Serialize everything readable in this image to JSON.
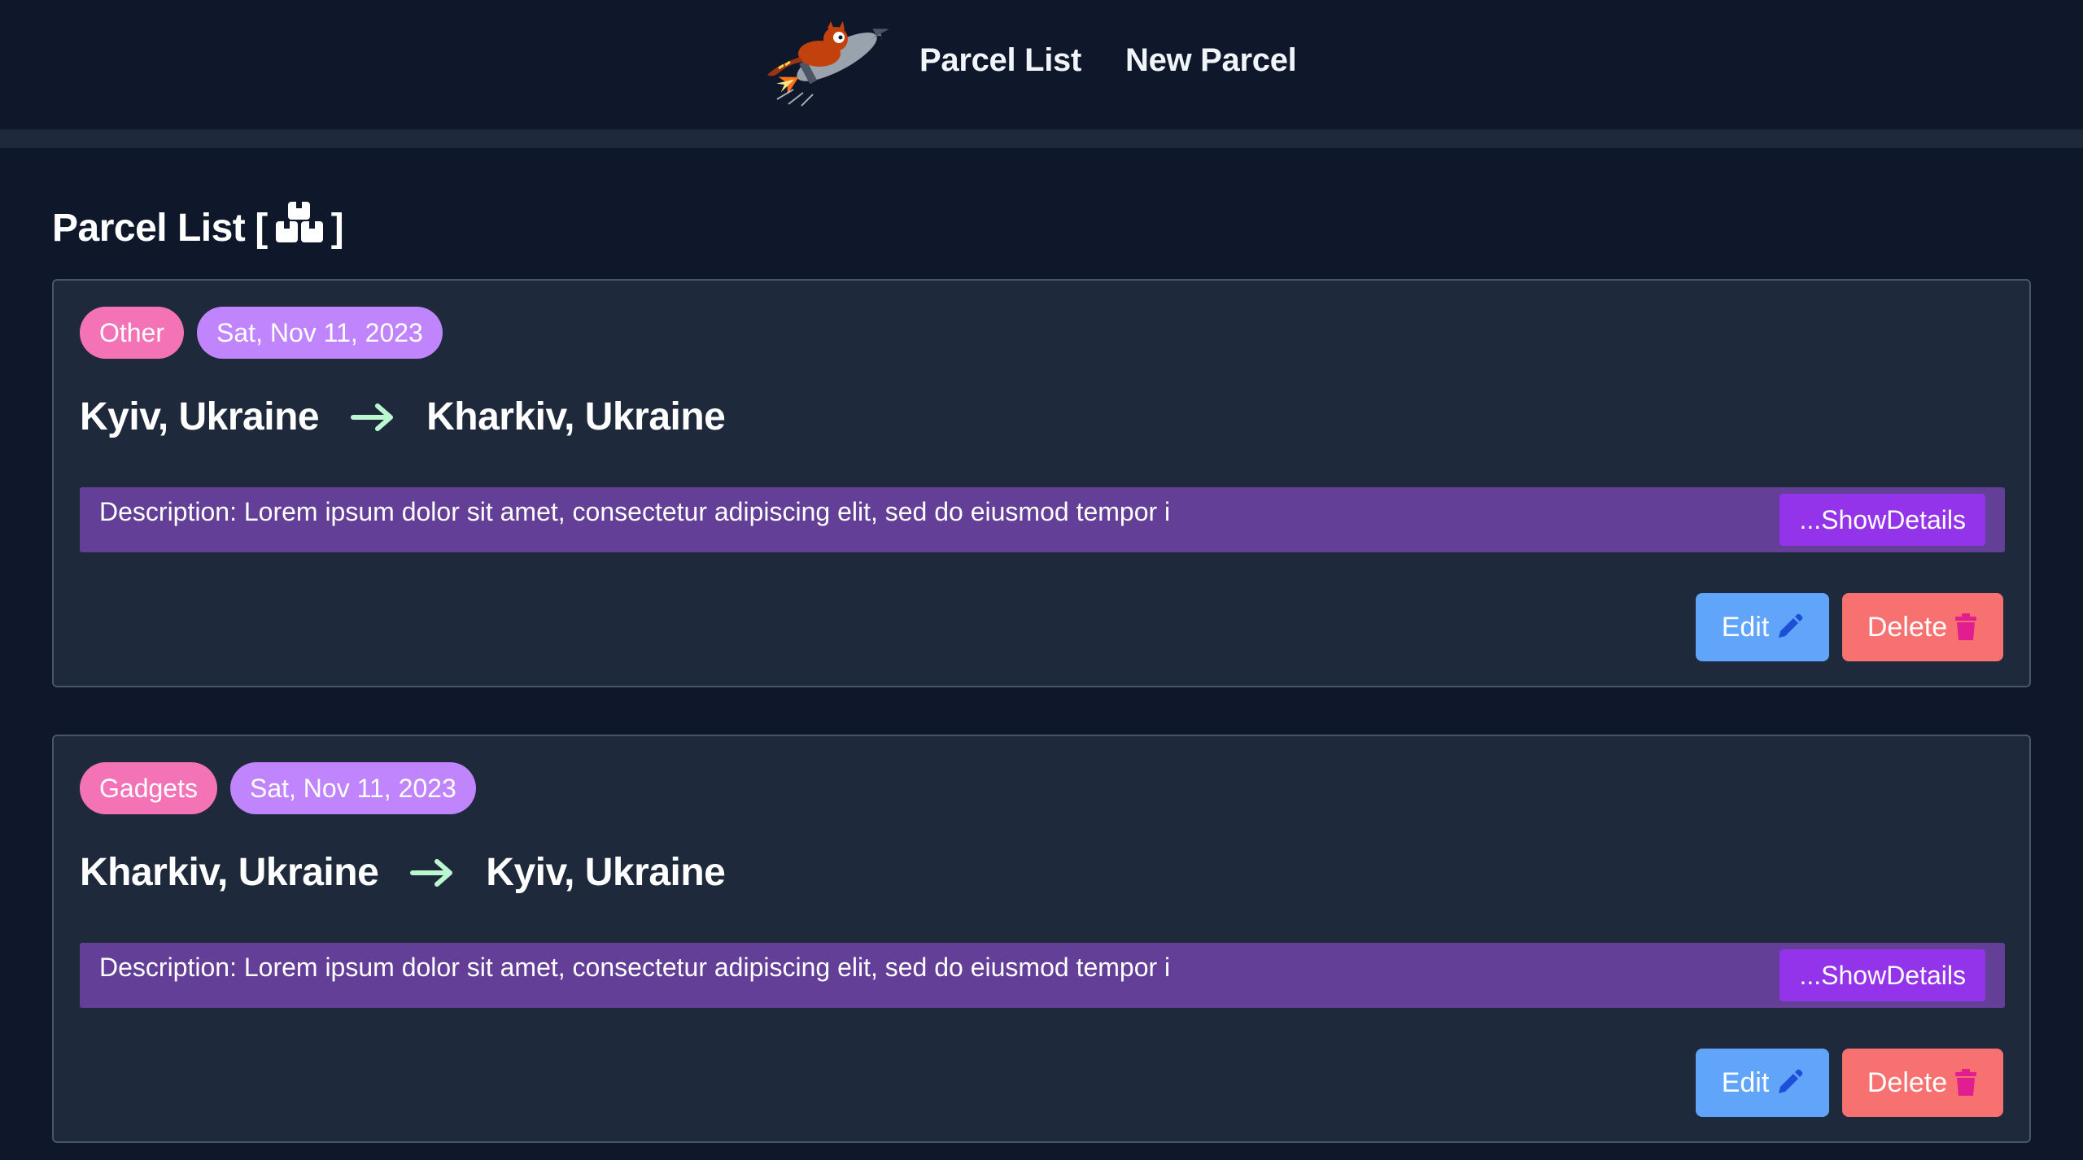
{
  "nav": {
    "logo_icon": "red-panda-rocket-logo",
    "links": [
      "Parcel List",
      "New Parcel"
    ]
  },
  "page": {
    "title": "Parcel List",
    "title_icon": "boxes-icon",
    "bracket_open": "[",
    "bracket_close": "]"
  },
  "parcels": [
    {
      "category": "Other",
      "date": "Sat, Nov 11, 2023",
      "from": "Kyiv, Ukraine",
      "to": "Kharkiv, Ukraine",
      "description": "Description: Lorem ipsum dolor sit amet, consectetur adipiscing elit, sed do eiusmod tempor i",
      "show_details_label": "...ShowDetails",
      "edit_label": "Edit",
      "delete_label": "Delete"
    },
    {
      "category": "Gadgets",
      "date": "Sat, Nov 11, 2023",
      "from": "Kharkiv, Ukraine",
      "to": "Kyiv, Ukraine",
      "description": "Description: Lorem ipsum dolor sit amet, consectetur adipiscing elit, sed do eiusmod tempor i",
      "show_details_label": "...ShowDetails",
      "edit_label": "Edit",
      "delete_label": "Delete"
    }
  ],
  "colors": {
    "background": "#0f172a",
    "card": "#1e293b",
    "category_badge": "#f472b6",
    "date_badge": "#c084fc",
    "description_bar": "#643f98",
    "show_details": "#9333ea",
    "edit": "#60a5fa",
    "delete": "#f87171",
    "arrow": "#bbf7d0",
    "edit_icon": "#1d4ed8",
    "delete_icon": "#e11d8f"
  }
}
